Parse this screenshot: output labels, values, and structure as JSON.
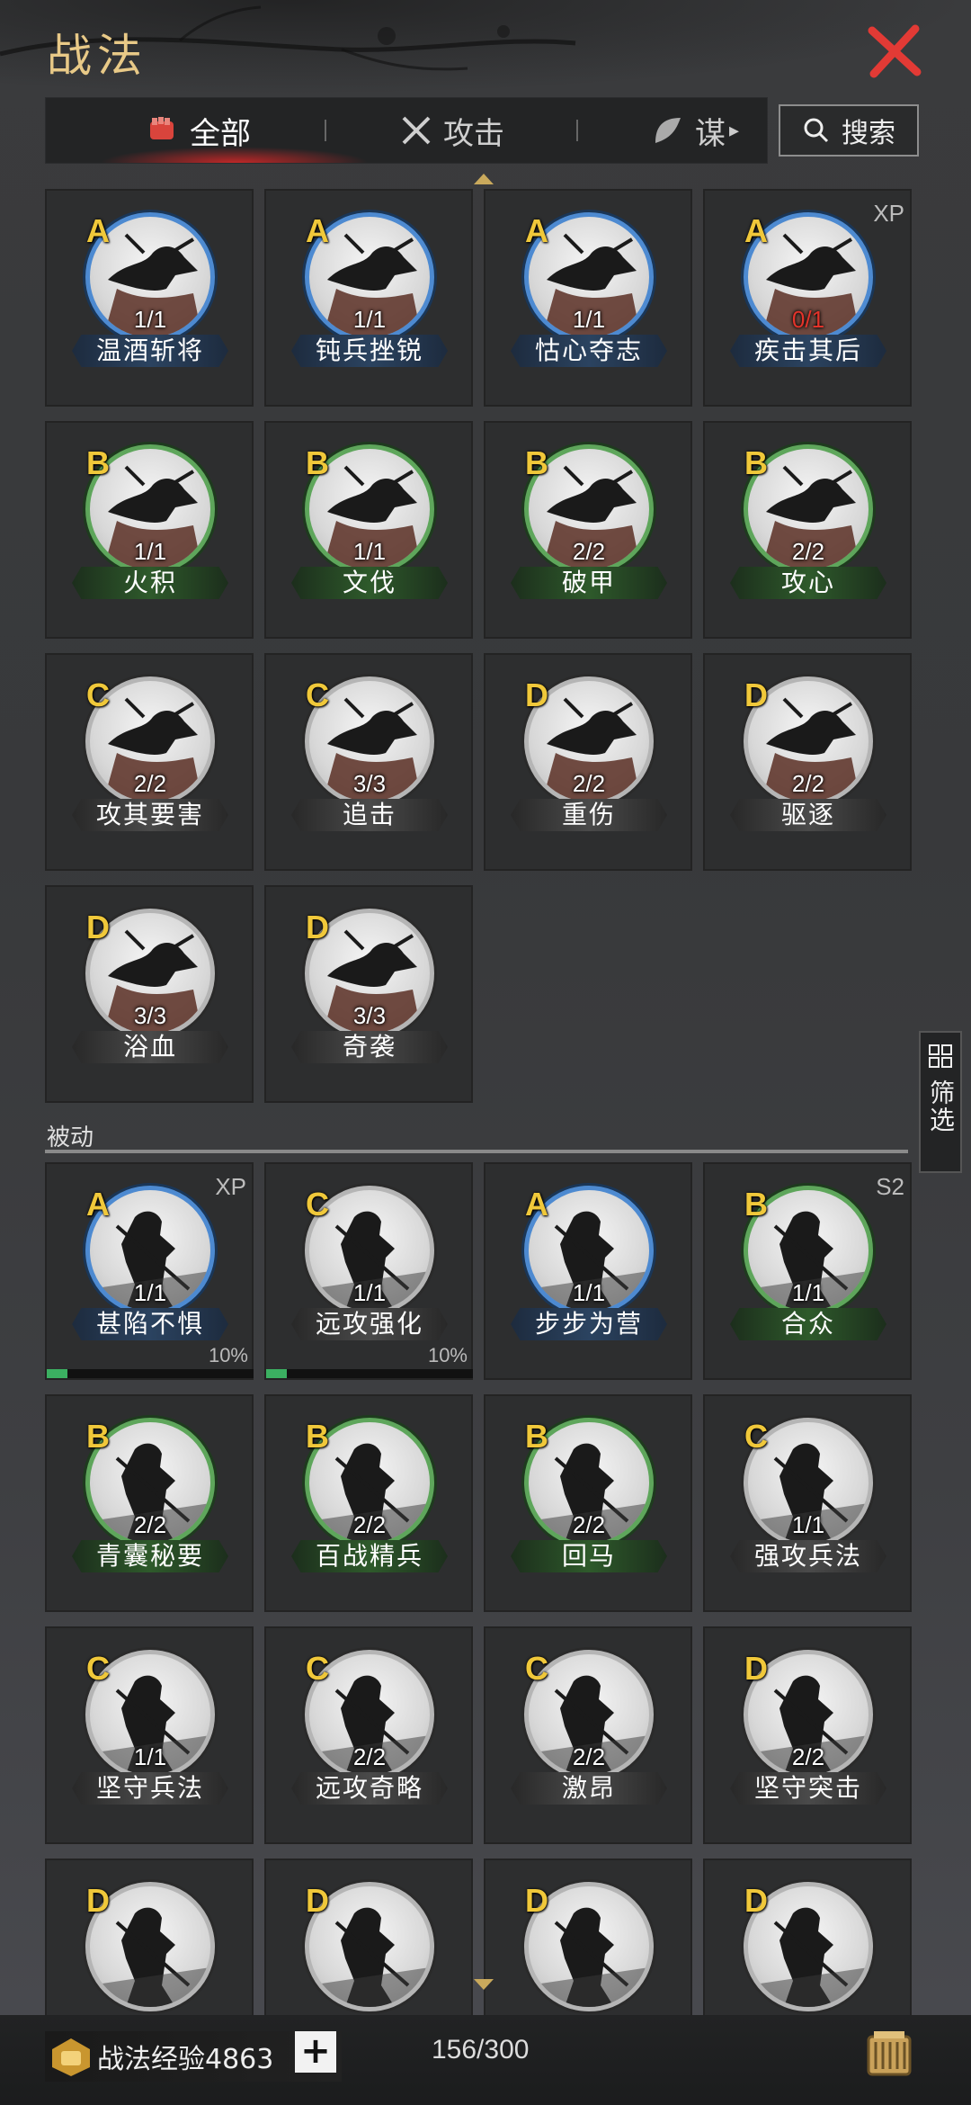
{
  "title": "战法",
  "tabs": [
    {
      "label": "全部",
      "icon": "fist-icon"
    },
    {
      "label": "攻击",
      "icon": "crossed-swords-icon"
    },
    {
      "label": "谋",
      "icon": "hand-fan-icon"
    }
  ],
  "search": {
    "label": "搜索"
  },
  "filter": {
    "label": "筛选"
  },
  "section_passive": "被动",
  "active_skills": [
    {
      "grade": "A",
      "count": "1/1",
      "name": "温酒斩将",
      "color": "blue"
    },
    {
      "grade": "A",
      "count": "1/1",
      "name": "钝兵挫锐",
      "color": "blue"
    },
    {
      "grade": "A",
      "count": "1/1",
      "name": "怙心夺志",
      "color": "blue"
    },
    {
      "grade": "A",
      "count": "0/1",
      "name": "疾击其后",
      "color": "blue",
      "tag": "XP",
      "count_red": true
    },
    {
      "grade": "B",
      "count": "1/1",
      "name": "火积",
      "color": "green"
    },
    {
      "grade": "B",
      "count": "1/1",
      "name": "文伐",
      "color": "green"
    },
    {
      "grade": "B",
      "count": "2/2",
      "name": "破甲",
      "color": "green"
    },
    {
      "grade": "B",
      "count": "2/2",
      "name": "攻心",
      "color": "green"
    },
    {
      "grade": "C",
      "count": "2/2",
      "name": "攻其要害",
      "color": "gray"
    },
    {
      "grade": "C",
      "count": "3/3",
      "name": "追击",
      "color": "gray"
    },
    {
      "grade": "D",
      "count": "2/2",
      "name": "重伤",
      "color": "gray"
    },
    {
      "grade": "D",
      "count": "2/2",
      "name": "驱逐",
      "color": "gray"
    },
    {
      "grade": "D",
      "count": "3/3",
      "name": "浴血",
      "color": "gray"
    },
    {
      "grade": "D",
      "count": "3/3",
      "name": "奇袭",
      "color": "gray"
    }
  ],
  "passive_skills": [
    {
      "grade": "A",
      "count": "1/1",
      "name": "甚陷不惧",
      "color": "blue",
      "tag": "XP",
      "progress": 0.1,
      "progress_label": "10%"
    },
    {
      "grade": "C",
      "count": "1/1",
      "name": "远攻强化",
      "color": "gray",
      "progress": 0.1,
      "progress_label": "10%"
    },
    {
      "grade": "A",
      "count": "1/1",
      "name": "步步为营",
      "color": "blue"
    },
    {
      "grade": "B",
      "count": "1/1",
      "name": "合众",
      "color": "green",
      "tag": "S2"
    },
    {
      "grade": "B",
      "count": "2/2",
      "name": "青囊秘要",
      "color": "green"
    },
    {
      "grade": "B",
      "count": "2/2",
      "name": "百战精兵",
      "color": "green"
    },
    {
      "grade": "B",
      "count": "2/2",
      "name": "回马",
      "color": "green"
    },
    {
      "grade": "C",
      "count": "1/1",
      "name": "强攻兵法",
      "color": "gray"
    },
    {
      "grade": "C",
      "count": "1/1",
      "name": "坚守兵法",
      "color": "gray"
    },
    {
      "grade": "C",
      "count": "2/2",
      "name": "远攻奇略",
      "color": "gray"
    },
    {
      "grade": "C",
      "count": "2/2",
      "name": "激昂",
      "color": "gray"
    },
    {
      "grade": "D",
      "count": "2/2",
      "name": "坚守突击",
      "color": "gray"
    },
    {
      "grade": "D",
      "count": "",
      "name": "",
      "color": "gray"
    },
    {
      "grade": "D",
      "count": "",
      "name": "",
      "color": "gray"
    },
    {
      "grade": "D",
      "count": "",
      "name": "",
      "color": "gray"
    },
    {
      "grade": "D",
      "count": "",
      "name": "",
      "color": "gray"
    }
  ],
  "footer": {
    "exp_label": "战法经验4863",
    "plus": "+",
    "capacity": "156/300"
  },
  "colors": {
    "accent_gold": "#e8c987",
    "close_red": "#e23a35",
    "grade_yellow": "#f0c83a"
  }
}
